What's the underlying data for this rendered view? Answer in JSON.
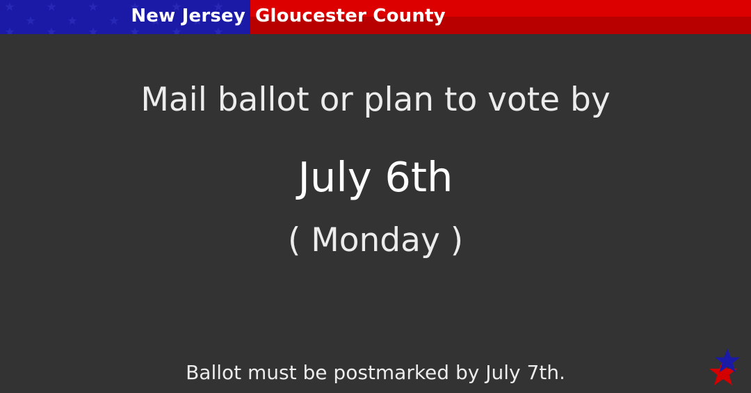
{
  "header": {
    "state": "New Jersey",
    "county": "Gloucester County",
    "colors": {
      "blue": "#1a1aa6",
      "red": "#dd0000",
      "red_dark": "#b80000"
    }
  },
  "main": {
    "headline": "Mail ballot or plan to vote by",
    "date": "July 6th",
    "weekday": "( Monday )"
  },
  "footer": {
    "note": "Ballot must be postmarked by July 7th.",
    "logo_icon": "star-icon"
  },
  "background_color": "#333333"
}
